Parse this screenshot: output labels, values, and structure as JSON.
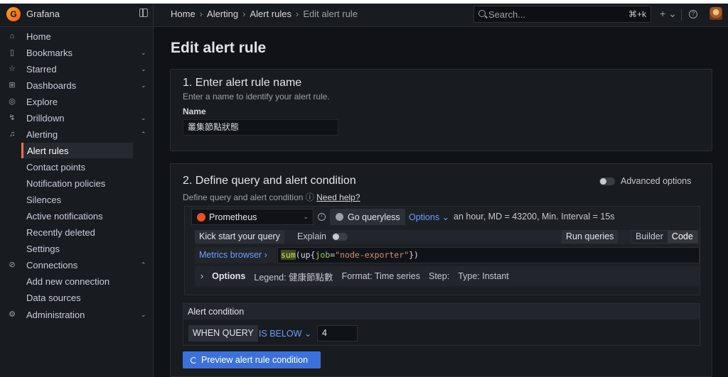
{
  "app": {
    "name": "Grafana"
  },
  "breadcrumbs": [
    "Home",
    "Alerting",
    "Alert rules",
    "Edit alert rule"
  ],
  "search": {
    "placeholder": "Search...",
    "shortcut": "⌘+k"
  },
  "sidebar": {
    "items": [
      {
        "label": "Home",
        "icon": "home-icon"
      },
      {
        "label": "Bookmarks",
        "icon": "bookmark-icon"
      },
      {
        "label": "Starred",
        "icon": "star-icon"
      },
      {
        "label": "Dashboards",
        "icon": "apps-icon"
      },
      {
        "label": "Explore",
        "icon": "compass-icon"
      },
      {
        "label": "Drilldown",
        "icon": "drilldown-icon"
      },
      {
        "label": "Alerting",
        "icon": "bell-icon"
      },
      {
        "label": "Alert rules"
      },
      {
        "label": "Contact points"
      },
      {
        "label": "Notification policies"
      },
      {
        "label": "Silences"
      },
      {
        "label": "Active notifications"
      },
      {
        "label": "Recently deleted"
      },
      {
        "label": "Settings"
      },
      {
        "label": "Connections",
        "icon": "connections-icon"
      },
      {
        "label": "Add new connection"
      },
      {
        "label": "Data sources"
      },
      {
        "label": "Administration",
        "icon": "gear-icon"
      }
    ]
  },
  "page": {
    "title": "Edit alert rule"
  },
  "section1": {
    "title": "1. Enter alert rule name",
    "desc": "Enter a name to identify your alert rule.",
    "name_label": "Name",
    "name_value": "叢集節點狀態"
  },
  "section2": {
    "title": "2. Define query and alert condition",
    "desc": "Define query and alert condition",
    "help_link": "Need help?",
    "advanced_options": "Advanced options",
    "datasource": "Prometheus",
    "go_queryless": "Go queryless",
    "options_link": "Options",
    "options_summary": "an hour, MD = 43200, Min. Interval = 15s",
    "kick_start": "Kick start your query",
    "explain": "Explain",
    "run_queries": "Run queries",
    "builder": "Builder",
    "code": "Code",
    "metrics_browser": "Metrics browser ›",
    "query": {
      "fn": "sum",
      "open": "(up{",
      "label": "job",
      "eq": "=",
      "value": "\"node-exporter\"",
      "close": "})"
    },
    "options_row": {
      "label": "Options",
      "legend": "Legend: 健康節點數",
      "format": "Format: Time series",
      "step": "Step:",
      "type": "Type: Instant"
    },
    "condition": {
      "title": "Alert condition",
      "when_query": "WHEN QUERY",
      "operator": "IS BELOW",
      "threshold": "4"
    },
    "preview_button": "Preview alert rule condition"
  }
}
